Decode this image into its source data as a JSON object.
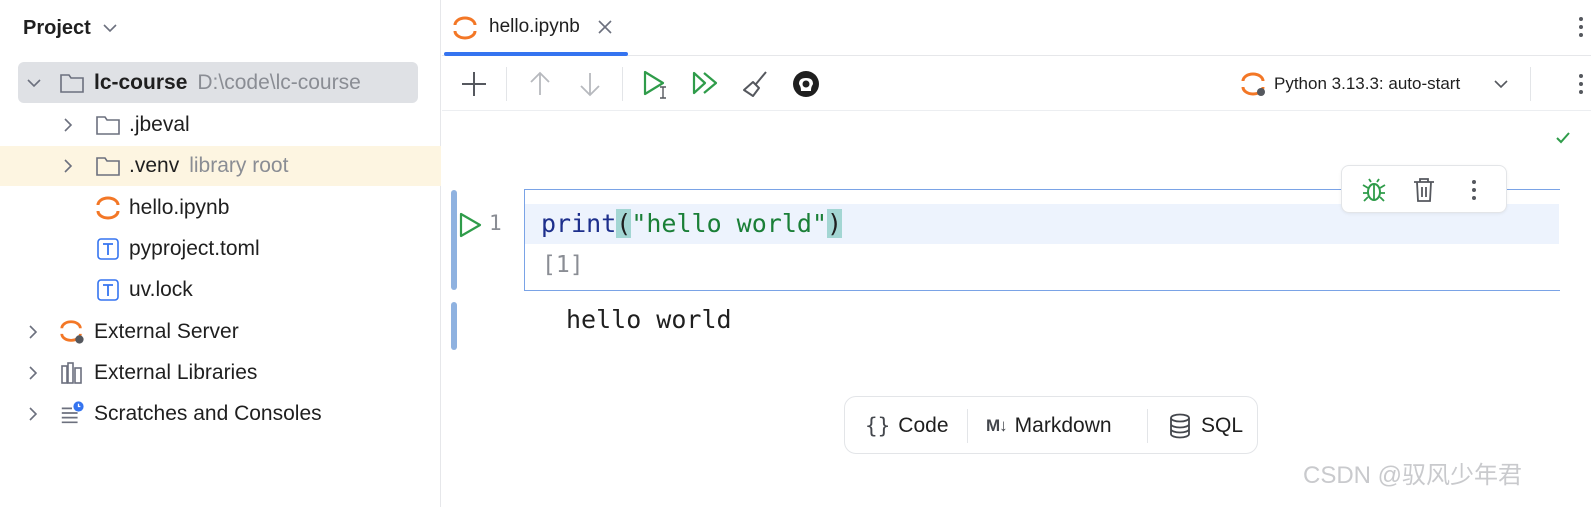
{
  "project_panel": {
    "title": "Project",
    "tree": {
      "root": {
        "name": "lc-course",
        "path": "D:\\code\\lc-course"
      },
      "jbeval": {
        "name": ".jbeval"
      },
      "venv": {
        "name": ".venv",
        "hint": "library root"
      },
      "hello": {
        "name": "hello.ipynb"
      },
      "pyproject": {
        "name": "pyproject.toml"
      },
      "uvlock": {
        "name": "uv.lock"
      },
      "external_server": {
        "name": "External Server"
      },
      "external_libraries": {
        "name": "External Libraries"
      },
      "scratches": {
        "name": "Scratches and Consoles"
      }
    }
  },
  "editor": {
    "tab": {
      "label": "hello.ipynb"
    },
    "kernel": {
      "label": "Python 3.13.3: auto-start"
    },
    "cell": {
      "line_number": "1",
      "code": {
        "fn": "print",
        "open": "(",
        "str": "\"hello world\"",
        "close": ")"
      },
      "exec_count": "[1]",
      "output": "hello world"
    },
    "add_cell": {
      "code_label": "Code",
      "markdown_glyph": "M↓",
      "markdown_label": "Markdown",
      "sql_label": "SQL"
    }
  },
  "watermark": "CSDN @驭风少年君",
  "colors": {
    "accent": "#3574f0",
    "run_green": "#2f9c4a",
    "selection_bg": "#dfe1e5",
    "library_root_bg": "#fdf5e1",
    "jupyter_orange": "#f37726"
  }
}
